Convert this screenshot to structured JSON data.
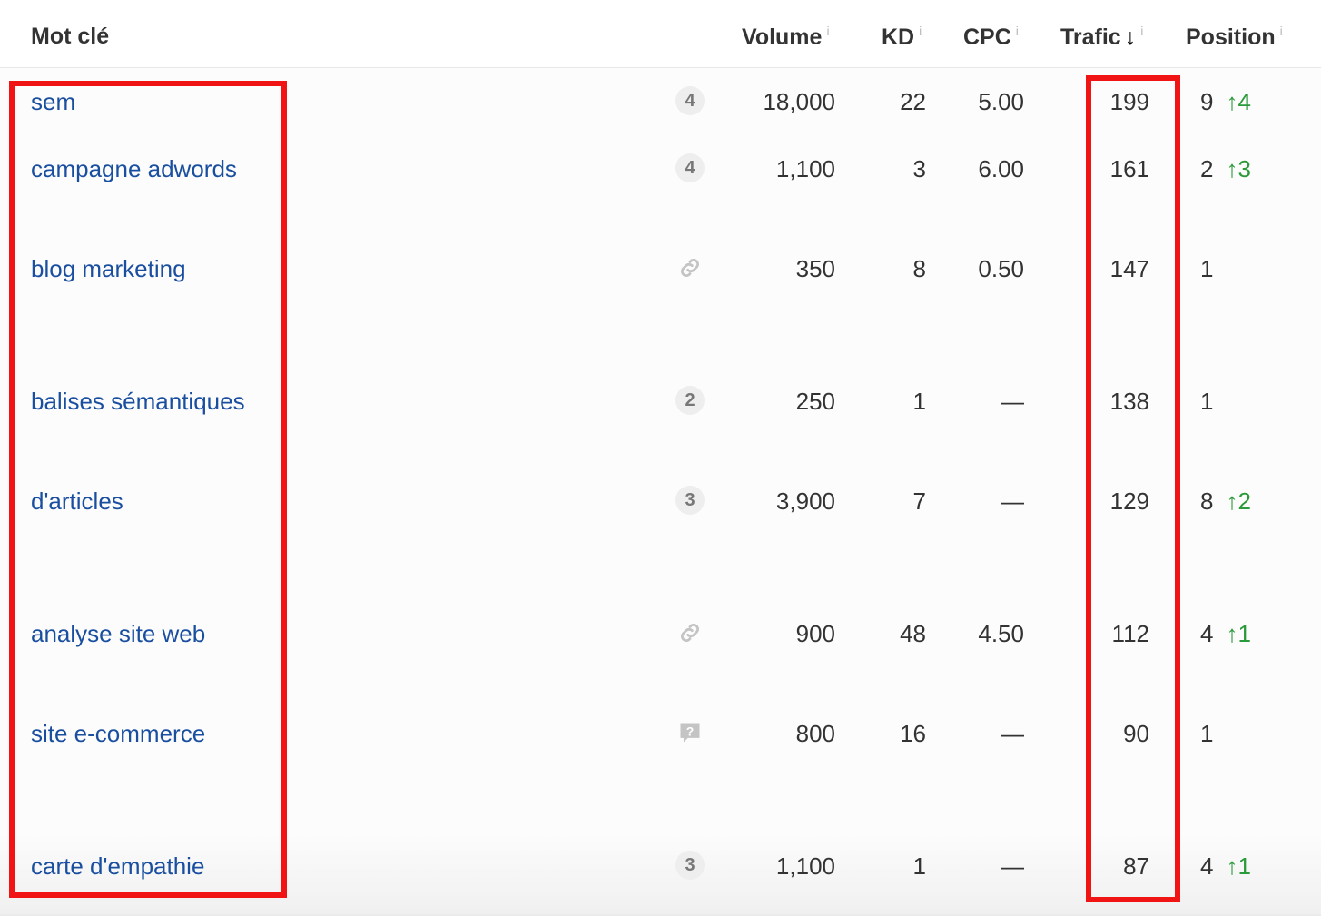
{
  "columns": {
    "keyword": "Mot clé",
    "volume": "Volume",
    "kd": "KD",
    "cpc": "CPC",
    "traffic": "Trafic",
    "position": "Position",
    "info": "i",
    "sort_arrow": "↓"
  },
  "rows": [
    {
      "keyword": "sem",
      "badge": "4",
      "icon": null,
      "volume": "18,000",
      "kd": "22",
      "cpc": "5.00",
      "traffic": "199",
      "position": "9",
      "change": "↑4"
    },
    {
      "keyword": "campagne adwords",
      "badge": "4",
      "icon": null,
      "volume": "1,100",
      "kd": "3",
      "cpc": "6.00",
      "traffic": "161",
      "position": "2",
      "change": "↑3"
    },
    {
      "keyword": "blog marketing",
      "badge": null,
      "icon": "link-icon",
      "volume": "350",
      "kd": "8",
      "cpc": "0.50",
      "traffic": "147",
      "position": "1",
      "change": ""
    },
    {
      "keyword": "balises sémantiques",
      "badge": "2",
      "icon": null,
      "volume": "250",
      "kd": "1",
      "cpc": "—",
      "traffic": "138",
      "position": "1",
      "change": ""
    },
    {
      "keyword": "d'articles",
      "badge": "3",
      "icon": null,
      "volume": "3,900",
      "kd": "7",
      "cpc": "—",
      "traffic": "129",
      "position": "8",
      "change": "↑2"
    },
    {
      "keyword": "analyse site web",
      "badge": null,
      "icon": "link-icon",
      "volume": "900",
      "kd": "48",
      "cpc": "4.50",
      "traffic": "112",
      "position": "4",
      "change": "↑1"
    },
    {
      "keyword": "site e-commerce",
      "badge": null,
      "icon": "question-bubble-icon",
      "volume": "800",
      "kd": "16",
      "cpc": "—",
      "traffic": "90",
      "position": "1",
      "change": ""
    },
    {
      "keyword": "carte d'empathie",
      "badge": "3",
      "icon": null,
      "volume": "1,100",
      "kd": "1",
      "cpc": "—",
      "traffic": "87",
      "position": "4",
      "change": "↑1"
    }
  ],
  "colors": {
    "link": "#1a4fa0",
    "highlight": "#f01414",
    "up": "#2a9a3a"
  }
}
